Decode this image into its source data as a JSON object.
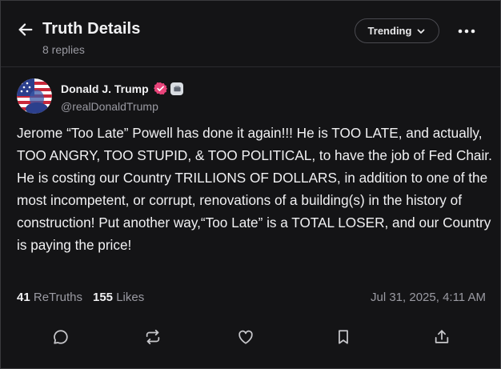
{
  "header": {
    "title": "Truth Details",
    "replies": "8 replies",
    "sort_label": "Trending"
  },
  "post": {
    "author_name": "Donald J. Trump",
    "author_handle": "@realDonaldTrump",
    "body": "Jerome “Too Late” Powell has done it again!!! He is TOO LATE, and actually, TOO ANGRY, TOO STUPID, & TOO POLITICAL, to have the job of Fed Chair. He is costing our Country TRILLIONS OF DOLLARS, in addition to one of the most incompetent, or corrupt, renovations of a building(s) in the history of construction! Put another way,“Too Late” is a TOTAL LOSER, and our Country is paying the price!",
    "retruths_count": "41",
    "retruths_label": "ReTruths",
    "likes_count": "155",
    "likes_label": "Likes",
    "timestamp": "Jul 31, 2025, 4:11 AM"
  },
  "icons": {
    "back": "arrow-left-icon",
    "sort": "chevron-down-icon",
    "more": "more-horizontal-icon",
    "verified": "verified-check-icon",
    "actions": [
      "reply-icon",
      "retruth-icon",
      "like-icon",
      "bookmark-icon",
      "share-icon"
    ]
  },
  "colors": {
    "background": "#141416",
    "text": "#f1f1f3",
    "muted": "#9a9aa2",
    "verified": "#e8447a"
  }
}
